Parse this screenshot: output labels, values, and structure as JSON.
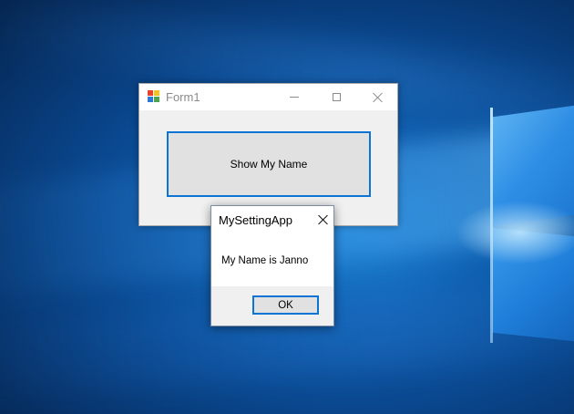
{
  "desktop": {
    "accent": "#0c74d4",
    "background": "#0a4a93"
  },
  "form1": {
    "title": "Form1",
    "icon": "winforms-app-icon",
    "caption_buttons": [
      "minimize-icon",
      "maximize-icon",
      "close-icon"
    ],
    "button_label": "Show My Name"
  },
  "msgbox": {
    "title": "MySettingApp",
    "message": "My Name is Janno",
    "ok_label": "OK"
  }
}
